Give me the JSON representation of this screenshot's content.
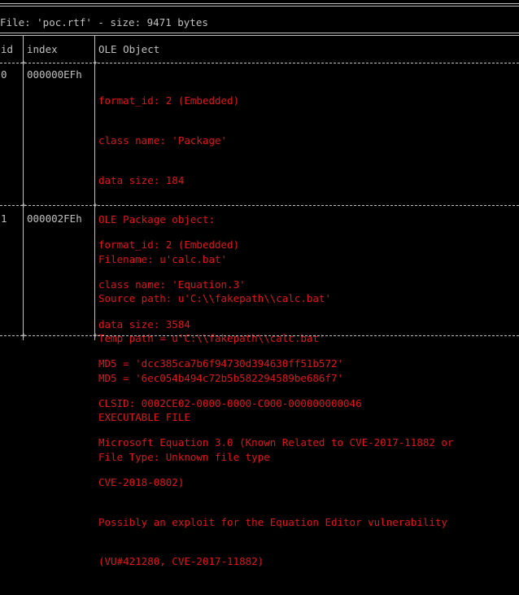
{
  "colors": {
    "background": "#000000",
    "text": "#c0c0c0",
    "highlight": "#e0161a"
  },
  "file_line": "File: 'poc.rtf' - size: 9471 bytes",
  "headers": {
    "id": "id",
    "index": "index",
    "ole": "OLE Object"
  },
  "rows": [
    {
      "id": "0",
      "index": "000000EFh",
      "lines": [
        "format_id: 2 (Embedded)",
        "class name: 'Package'",
        "data size: 184",
        "OLE Package object:",
        "Filename: u'calc.bat'",
        "Source path: u'C:\\\\fakepath\\\\calc.bat'",
        "Temp path = u'C:\\\\fakepath\\\\calc.bat'",
        "MD5 = '6ec054b494c72b5b582294589be686f7'",
        "EXECUTABLE FILE",
        "File Type: Unknown file type"
      ]
    },
    {
      "id": "1",
      "index": "000002FEh",
      "lines": [
        "format_id: 2 (Embedded)",
        "class name: 'Equation.3'",
        "data size: 3584",
        "MD5 = 'dcc385ca7b6f94730d394630ff51b572'",
        "CLSID: 0002CE02-0000-0000-C000-000000000046",
        "Microsoft Equation 3.0 (Known Related to CVE-2017-11882 or",
        "CVE-2018-0802)",
        "Possibly an exploit for the Equation Editor vulnerability",
        "(VU#421280, CVE-2017-11882)"
      ]
    }
  ]
}
